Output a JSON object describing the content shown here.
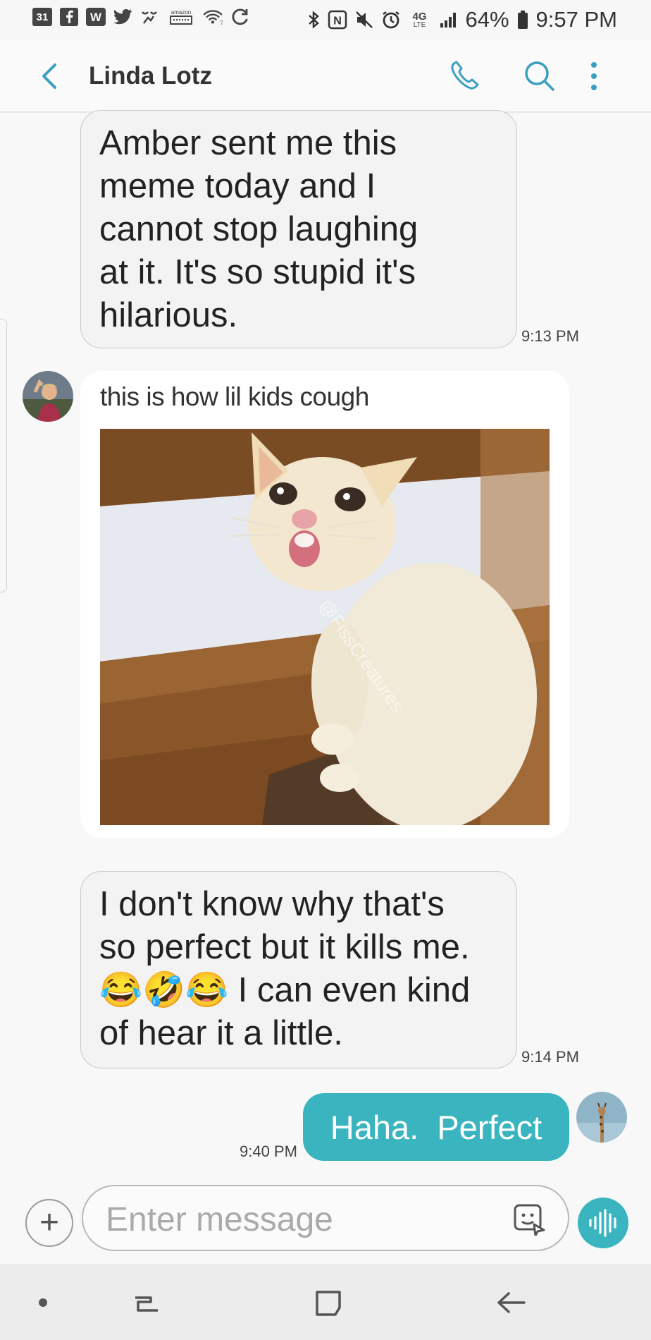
{
  "status_bar": {
    "calendar_day": "31",
    "battery": "64%",
    "time": "9:57 PM",
    "network": "4G",
    "network_sub": "LTE",
    "icons": [
      "calendar-icon",
      "facebook-icon",
      "wordpress-icon",
      "twitter-icon",
      "sleep-icon",
      "amazon-icon",
      "wifi-icon",
      "sync-icon",
      "bluetooth-icon",
      "nfc-icon",
      "mute-icon",
      "alarm-icon",
      "signal-icon",
      "battery-icon"
    ]
  },
  "header": {
    "contact_name": "Linda Lotz",
    "icons": [
      "back-icon",
      "phone-icon",
      "search-icon",
      "more-icon"
    ]
  },
  "messages": [
    {
      "direction": "incoming",
      "lines": [
        "Amber sent me this",
        "meme today and I",
        "cannot stop laughing",
        "at it. It's so stupid it's",
        "hilarious."
      ],
      "time": "9:13 PM"
    },
    {
      "direction": "incoming",
      "type": "image",
      "caption": "this is how lil kids cough",
      "watermark": "@FissCreatures"
    },
    {
      "direction": "incoming",
      "lines": [
        "I don't know why that's",
        "so perfect but it kills me.",
        "I can even kind",
        "of hear it a little."
      ],
      "emojis": [
        "😂",
        "🤣",
        "😂"
      ],
      "time": "9:14 PM"
    },
    {
      "direction": "outgoing",
      "text": "Haha.  Perfect",
      "time": "9:40 PM"
    }
  ],
  "compose": {
    "placeholder": "Enter message",
    "icons": [
      "add-icon",
      "sticker-icon",
      "voice-icon"
    ]
  },
  "navbar": {
    "icons": [
      "dot-icon",
      "recents-icon",
      "home-icon",
      "back-nav-icon"
    ]
  },
  "colors": {
    "accent": "#3ab5bf",
    "header_icons": "#3a9fc0",
    "bubble_in": "#f3f3f3",
    "background": "#f8f8f8"
  }
}
